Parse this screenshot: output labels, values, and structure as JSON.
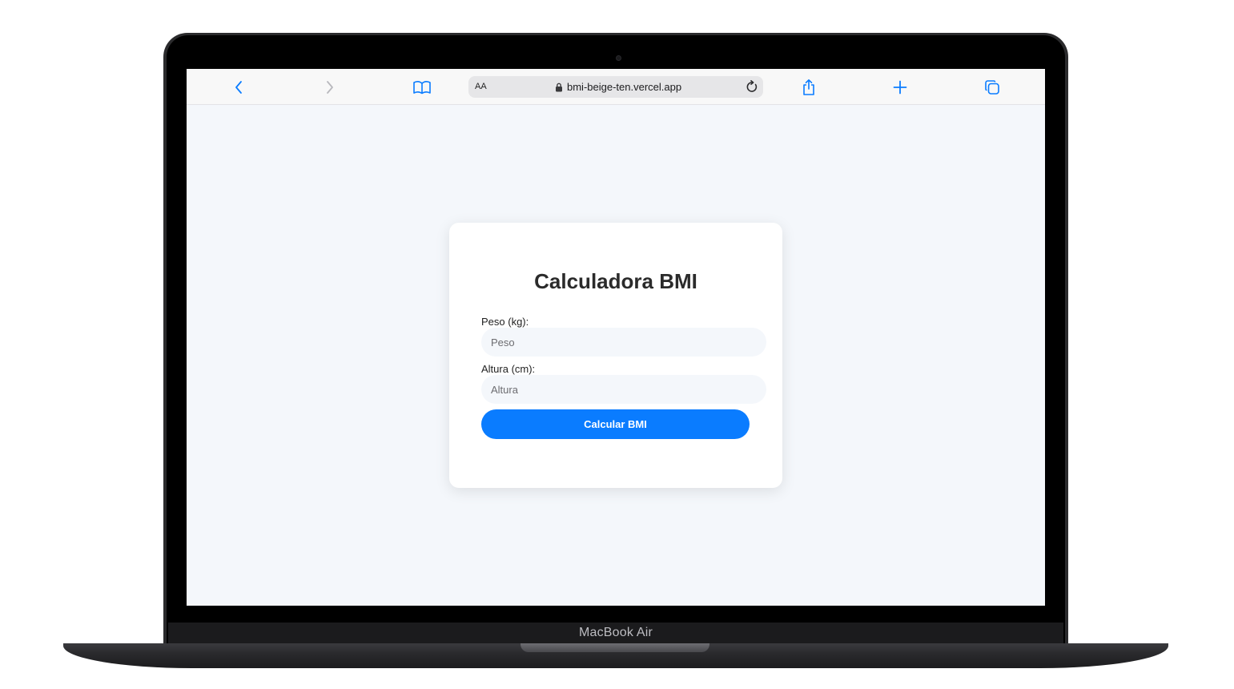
{
  "device": {
    "model_label": "MacBook Air"
  },
  "browser": {
    "address_bar": {
      "reader_label": "AA",
      "url": "bmi-beige-ten.vercel.app"
    },
    "icons": {
      "back": "chevron-left-icon",
      "forward": "chevron-right-icon",
      "bookmarks": "book-icon",
      "lock": "lock-icon",
      "reload": "reload-icon",
      "share": "share-icon",
      "new_tab": "plus-icon",
      "tabs": "tabs-icon"
    },
    "accent_color": "#0a7cff"
  },
  "page": {
    "title": "Calculadora BMI",
    "weight": {
      "label": "Peso (kg):",
      "placeholder": "Peso",
      "value": ""
    },
    "height": {
      "label": "Altura (cm):",
      "placeholder": "Altura",
      "value": ""
    },
    "submit_label": "Calcular BMI",
    "button_color": "#0a7cff",
    "background_color": "#f4f7fb"
  }
}
